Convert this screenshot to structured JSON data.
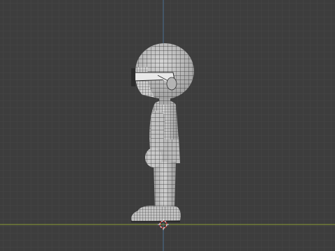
{
  "viewport": {
    "background": "#3d3d3d",
    "grid_minor_color": "#464646",
    "grid_major_color": "#4a4a4a",
    "axis_x_color": "#8a9a34",
    "axis_z_color": "#4a6f8f",
    "origin_icon": "3d-cursor-icon",
    "object_icon": "character-mesh-wireframe"
  },
  "model": {
    "surface_color": "#bdbdbd",
    "shade_color": "#8f8f8f",
    "wire_color": "#2c2c2c",
    "glasses_color": "#e8e8e8"
  }
}
